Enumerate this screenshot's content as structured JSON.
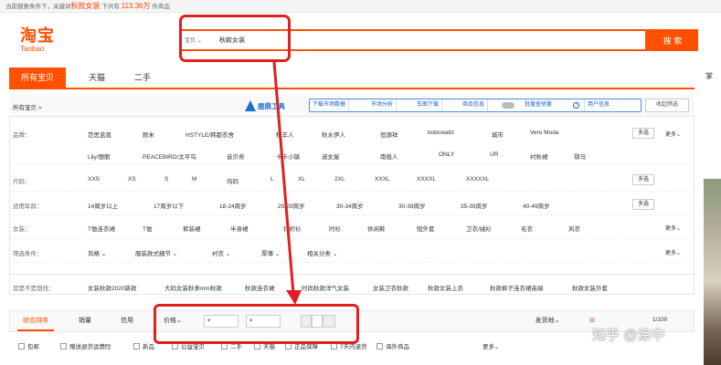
{
  "topbar": {
    "text_before": "当前搜索条件下，关键词",
    "keyword": "秋款女装",
    "text_mid": "下共有",
    "count": "113.36万",
    "text_after": "件商品"
  },
  "logo": {
    "cn": "淘宝",
    "en": "Taobao"
  },
  "search": {
    "type_label": "宝贝",
    "query": "秋款女装",
    "button": "搜 索"
  },
  "tabs": [
    "所有宝贝",
    "天猫",
    "二手"
  ],
  "right_sidebar_word": "掌",
  "crumb": "所有宝贝 >",
  "tool_logo_text": "鹿鼎工具",
  "toolbar": [
    "下载市场数据",
    "市场分析",
    "车图下载",
    "商品信息",
    "批量查销量",
    "用户信息"
  ],
  "collapse_label": "收起筛选",
  "filters": {
    "brand": {
      "label": "品牌：",
      "options_row1": [
        "范思蓝恩",
        "欧米",
        "HSTYLE/韩都衣舍",
        "稚羊人",
        "秋水伊人",
        "恒源祥",
        "bobowaltz",
        "城市",
        "Vero Moda"
      ],
      "options_row2": [
        "Lily/丽丽",
        "PEACEBIRD/太平鸟",
        "音贝奇",
        "卡卡小镇",
        "淑女屋",
        "南极人",
        "ONLY",
        "UR",
        "衬秋裙",
        "鄂马"
      ]
    },
    "size": {
      "label": "尺码：",
      "options": [
        "XXS",
        "XS",
        "S",
        "M",
        "均码",
        "L",
        "XL",
        "2XL",
        "XXXL",
        "XXXXL",
        "XXXXXL"
      ]
    },
    "age": {
      "label": "适用年龄：",
      "options": [
        "14周岁以上",
        "17周岁以下",
        "18-24周岁",
        "25-29周岁",
        "30-34周岁",
        "30-39周岁",
        "35-39周岁",
        "40-49周岁"
      ]
    },
    "category": {
      "label": "女装：",
      "options": [
        "T恤连衣裙",
        "T恤",
        "裤装裙",
        "半身裙",
        "针织衫",
        "时衫",
        "休闲裤",
        "短外套",
        "卫衣/绒衫",
        "毛衣",
        "风衣"
      ]
    },
    "other": {
      "label": "筛选条件：",
      "options": [
        "风格",
        "服装款式细节",
        "衬衣",
        "厚薄",
        "相关分类"
      ]
    },
    "multi": "多选",
    "more": "更多"
  },
  "guess": {
    "label": "您是不是想找：",
    "options": [
      "女装秋款2020新款",
      "大码女装秋季mm秋款",
      "秋款连衣裙",
      "时尚秋款洋气女装",
      "女装卫衣秋款",
      "秋款女装上衣",
      "秋款裤子连衣裙高端",
      "秋款女装外套"
    ]
  },
  "sortbar": {
    "items": [
      "综合排序",
      "销量",
      "信用",
      "价格"
    ],
    "price_min_placeholder": "¥",
    "price_max_placeholder": "¥",
    "ship_from": "发货地",
    "pager": "1/100"
  },
  "checks": [
    "包邮",
    "赠送退货运费险",
    "新品",
    "公益宝贝",
    "二手",
    "天猫",
    "正品保障",
    "7天内退货",
    "海外商品"
  ],
  "checks_more": "更多",
  "watermark": "知乎 @涂中",
  "colors": {
    "brand": "#ff5000",
    "annotation": "#e02020",
    "tool_blue": "#1a6fd1"
  }
}
